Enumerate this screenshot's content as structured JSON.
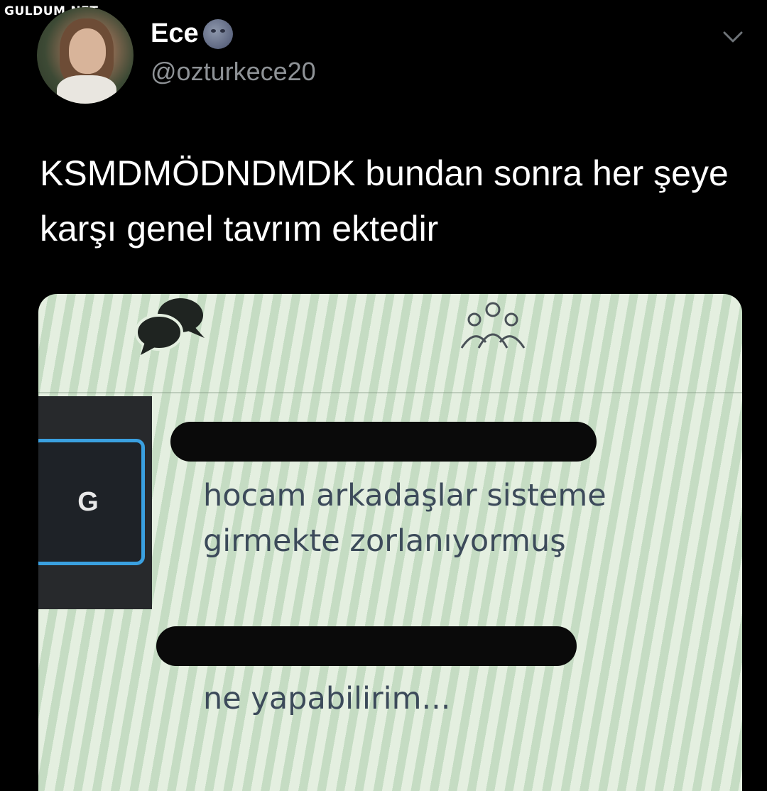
{
  "watermark": "GULDUM.NET",
  "author": {
    "name": "Ece",
    "handle": "@ozturkece20",
    "name_emoji_icon": "new-moon-face-icon"
  },
  "tweet": {
    "text": "KSMDMÖDNDMDK bundan sonra her şeye karşı genel tavrım ektedir"
  },
  "media": {
    "tile_letter": "G",
    "message1": "hocam arkadaşlar sisteme girmekte zorlanıyormuş",
    "message2": "ne yapabilirim...",
    "icons": [
      "chat-bubbles-icon",
      "people-group-icon"
    ]
  },
  "colors": {
    "background": "#000000",
    "handle": "#8e9296",
    "tile_border": "#3aa0e0"
  }
}
